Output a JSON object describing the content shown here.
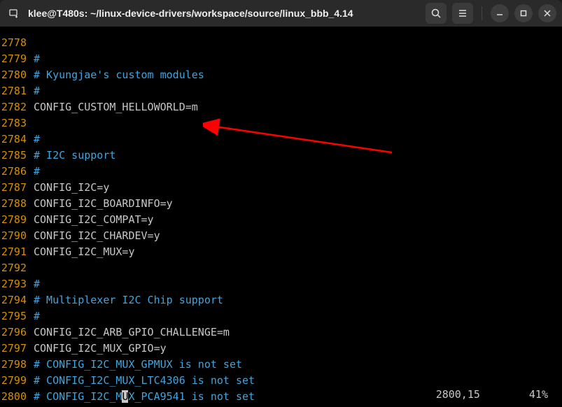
{
  "titlebar": {
    "title": "klee@T480s: ~/linux-device-drivers/workspace/source/linux_bbb_4.14"
  },
  "lines": [
    {
      "num": "2778",
      "segments": []
    },
    {
      "num": "2779",
      "segments": [
        {
          "cls": "comment",
          "text": "#"
        }
      ]
    },
    {
      "num": "2780",
      "segments": [
        {
          "cls": "comment",
          "text": "# Kyungjae's custom modules"
        }
      ]
    },
    {
      "num": "2781",
      "segments": [
        {
          "cls": "comment",
          "text": "#"
        }
      ]
    },
    {
      "num": "2782",
      "segments": [
        {
          "cls": "txt",
          "text": "CONFIG_CUSTOM_HELLOWORLD=m"
        }
      ]
    },
    {
      "num": "2783",
      "segments": []
    },
    {
      "num": "2784",
      "segments": [
        {
          "cls": "comment",
          "text": "#"
        }
      ]
    },
    {
      "num": "2785",
      "segments": [
        {
          "cls": "comment",
          "text": "# I2C support"
        }
      ]
    },
    {
      "num": "2786",
      "segments": [
        {
          "cls": "comment",
          "text": "#"
        }
      ]
    },
    {
      "num": "2787",
      "segments": [
        {
          "cls": "txt",
          "text": "CONFIG_I2C=y"
        }
      ]
    },
    {
      "num": "2788",
      "segments": [
        {
          "cls": "txt",
          "text": "CONFIG_I2C_BOARDINFO=y"
        }
      ]
    },
    {
      "num": "2789",
      "segments": [
        {
          "cls": "txt",
          "text": "CONFIG_I2C_COMPAT=y"
        }
      ]
    },
    {
      "num": "2790",
      "segments": [
        {
          "cls": "txt",
          "text": "CONFIG_I2C_CHARDEV=y"
        }
      ]
    },
    {
      "num": "2791",
      "segments": [
        {
          "cls": "txt",
          "text": "CONFIG_I2C_MUX=y"
        }
      ]
    },
    {
      "num": "2792",
      "segments": []
    },
    {
      "num": "2793",
      "segments": [
        {
          "cls": "comment",
          "text": "#"
        }
      ]
    },
    {
      "num": "2794",
      "segments": [
        {
          "cls": "comment",
          "text": "# Multiplexer I2C Chip support"
        }
      ]
    },
    {
      "num": "2795",
      "segments": [
        {
          "cls": "comment",
          "text": "#"
        }
      ]
    },
    {
      "num": "2796",
      "segments": [
        {
          "cls": "txt",
          "text": "CONFIG_I2C_ARB_GPIO_CHALLENGE=m"
        }
      ]
    },
    {
      "num": "2797",
      "segments": [
        {
          "cls": "txt",
          "text": "CONFIG_I2C_MUX_GPIO=y"
        }
      ]
    },
    {
      "num": "2798",
      "segments": [
        {
          "cls": "comment",
          "text": "# CONFIG_I2C_MUX_GPMUX is not set"
        }
      ]
    },
    {
      "num": "2799",
      "segments": [
        {
          "cls": "comment",
          "text": "# CONFIG_I2C_MUX_LTC4306 is not set"
        }
      ]
    },
    {
      "num": "2800",
      "segments": [
        {
          "cls": "comment",
          "text": "# CONFIG_I2C_M"
        },
        {
          "cls": "cursor",
          "text": "U"
        },
        {
          "cls": "comment",
          "text": "X_PCA9541 is not set"
        }
      ]
    }
  ],
  "status": {
    "position": "2800,15",
    "percent": "41%"
  },
  "arrow": {
    "color": "#ff0000"
  }
}
